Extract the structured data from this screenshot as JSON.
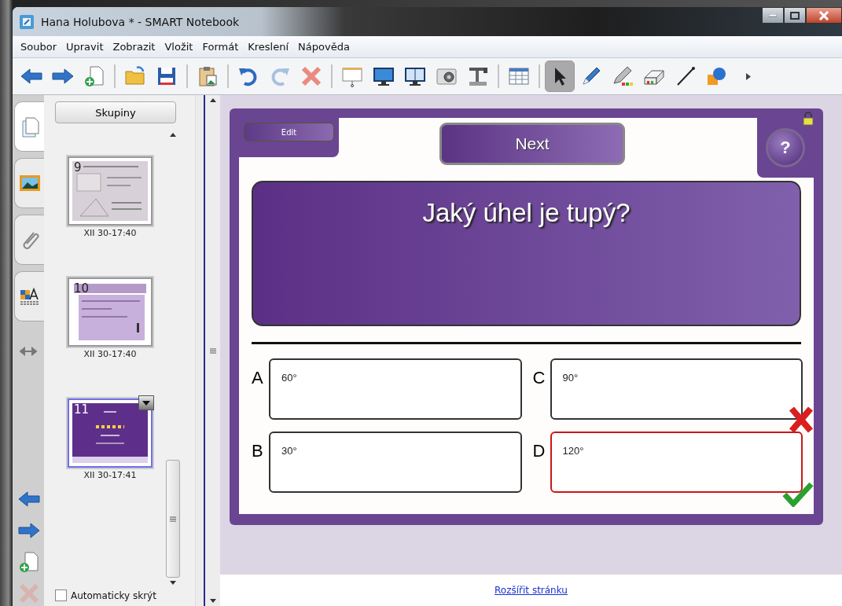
{
  "window": {
    "title": "Hana Holubova * - SMART Notebook"
  },
  "menu": [
    "Soubor",
    "Upravit",
    "Zobrazit",
    "Vložit",
    "Formát",
    "Kreslení",
    "Nápověda"
  ],
  "toolbar": [
    [
      {
        "kind": "back",
        "selected": false
      },
      {
        "kind": "forward",
        "selected": false
      },
      {
        "kind": "new-page",
        "selected": false
      }
    ],
    [
      {
        "kind": "open",
        "selected": false
      },
      {
        "kind": "save",
        "selected": false
      }
    ],
    [
      {
        "kind": "paste",
        "selected": false
      }
    ],
    [
      {
        "kind": "undo",
        "selected": false
      },
      {
        "kind": "redo",
        "selected": false
      },
      {
        "kind": "delete",
        "selected": false
      }
    ],
    [
      {
        "kind": "screen-shade",
        "selected": false
      },
      {
        "kind": "monitor",
        "selected": false
      },
      {
        "kind": "dual-monitor",
        "selected": false
      },
      {
        "kind": "camera",
        "selected": false
      },
      {
        "kind": "document-camera",
        "selected": false
      }
    ],
    [
      {
        "kind": "table",
        "selected": false
      }
    ],
    [
      {
        "kind": "pointer",
        "selected": true
      },
      {
        "kind": "pen",
        "selected": false
      },
      {
        "kind": "highlighter",
        "selected": false
      },
      {
        "kind": "eraser",
        "selected": false
      },
      {
        "kind": "line",
        "selected": false
      },
      {
        "kind": "shapes",
        "selected": false
      },
      {
        "kind": "more",
        "selected": false
      }
    ]
  ],
  "side_tabs": [
    {
      "kind": "pages",
      "selected": true
    },
    {
      "kind": "gallery",
      "selected": false
    },
    {
      "kind": "attachments",
      "selected": false
    },
    {
      "kind": "properties",
      "selected": false
    }
  ],
  "side_nav": [
    {
      "kind": "back",
      "disabled": false
    },
    {
      "kind": "forward",
      "disabled": false
    },
    {
      "kind": "new-page",
      "disabled": false
    },
    {
      "kind": "delete",
      "disabled": true
    }
  ],
  "sorter": {
    "groups_button": "Skupiny",
    "pages": [
      {
        "number": "9",
        "time": "XII 30-17:40",
        "kind": "plain",
        "selected": false
      },
      {
        "number": "10",
        "time": "XII 30-17:40",
        "kind": "purple-list",
        "selected": false
      },
      {
        "number": "11",
        "time": "XII 30-17:41",
        "kind": "purple-quiz",
        "selected": true
      }
    ],
    "auto_hide": {
      "label": "Automaticky skrýt",
      "checked": false
    }
  },
  "slide": {
    "edit": "Edit",
    "next": "Next",
    "help": "?",
    "question": "Jaký úhel je tupý?",
    "answers": [
      {
        "letter": "A",
        "value": "60°",
        "correct": false,
        "wrong": false
      },
      {
        "letter": "C",
        "value": "90°",
        "correct": false,
        "wrong": true
      },
      {
        "letter": "B",
        "value": "30°",
        "correct": false,
        "wrong": false
      },
      {
        "letter": "D",
        "value": "120°",
        "correct": true,
        "wrong": false
      }
    ]
  },
  "footer_link": "Rozšířit stránku"
}
